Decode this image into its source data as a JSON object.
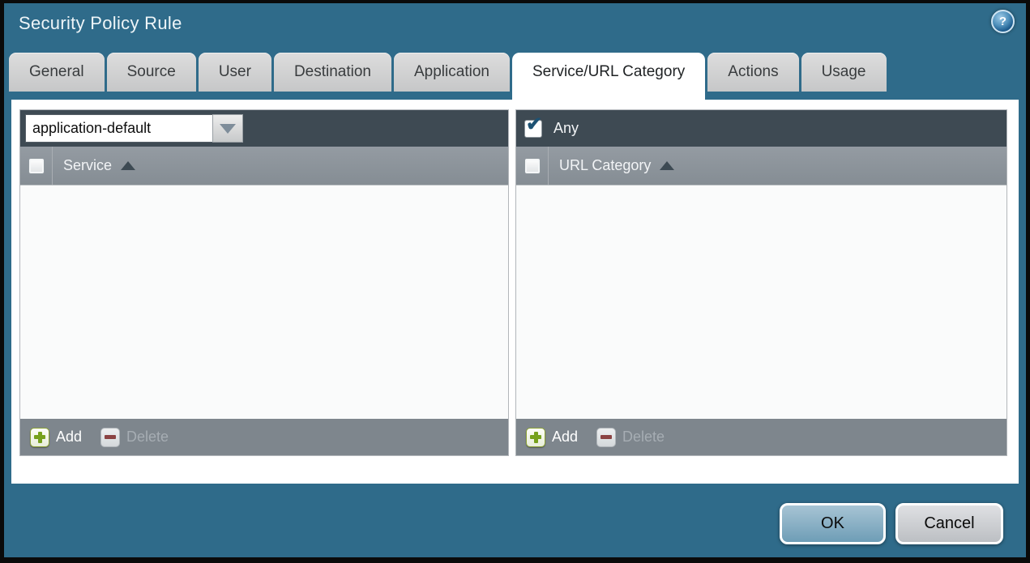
{
  "window": {
    "title": "Security Policy Rule"
  },
  "tabs": [
    {
      "label": "General",
      "active": false
    },
    {
      "label": "Source",
      "active": false
    },
    {
      "label": "User",
      "active": false
    },
    {
      "label": "Destination",
      "active": false
    },
    {
      "label": "Application",
      "active": false
    },
    {
      "label": "Service/URL Category",
      "active": true
    },
    {
      "label": "Actions",
      "active": false
    },
    {
      "label": "Usage",
      "active": false
    }
  ],
  "service_panel": {
    "dropdown": {
      "value": "application-default"
    },
    "column_header": "Service",
    "sort": "ascending",
    "rows": [],
    "footer": {
      "add_label": "Add",
      "delete_label": "Delete",
      "delete_enabled": false
    }
  },
  "url_category_panel": {
    "any_checkbox": {
      "label": "Any",
      "checked": true
    },
    "column_header": "URL Category",
    "sort": "ascending",
    "rows": [],
    "footer": {
      "add_label": "Add",
      "delete_label": "Delete",
      "delete_enabled": false
    }
  },
  "buttons": {
    "ok": "OK",
    "cancel": "Cancel"
  },
  "icons": {
    "help": "?",
    "check": "✔"
  },
  "colors": {
    "dialog_background": "#2f6b8a",
    "frame_border": "#0a0a0a",
    "panel_header_dark": "#3e4a53",
    "column_header_gray": "#8b929a",
    "footer_bar_gray": "#7e868d",
    "tab_inactive": "#cfd0d1",
    "tab_active": "#ffffff",
    "ok_button_blue": "#7fa9c0",
    "cancel_button_gray": "#caccd0",
    "add_icon_green": "#76a11c",
    "delete_icon_red": "#8b4343",
    "checkmark_blue": "#1d5273"
  }
}
